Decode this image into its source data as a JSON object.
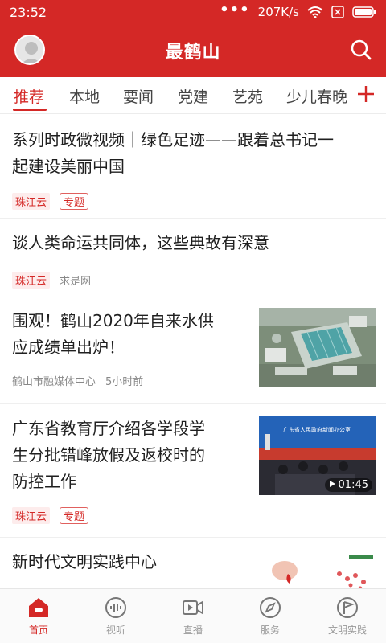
{
  "status_bar": {
    "time": "23:52",
    "dots": "•••",
    "speed": "207K/s"
  },
  "header": {
    "title": "最鹤山",
    "avatar_icon": "user-avatar-icon",
    "search_icon": "search-icon"
  },
  "tabs": {
    "items": [
      {
        "label": "推荐",
        "active": true
      },
      {
        "label": "本地"
      },
      {
        "label": "要闻"
      },
      {
        "label": "党建"
      },
      {
        "label": "艺苑"
      },
      {
        "label": "少儿春晚"
      }
    ],
    "add_icon": "plus-icon"
  },
  "feed": [
    {
      "title_line1": "系列时政微视频｜绿色足迹——跟着总书记一",
      "title_line2": "起建设美丽中国",
      "source": "珠江云",
      "tag": "专题"
    },
    {
      "title_line1": "谈人类命运共同体，这些典故有深意",
      "source": "珠江云",
      "source2": "求是网"
    },
    {
      "title_line1": "围观！鹤山2020年自来水供",
      "title_line2": "应成绩单出炉！",
      "source": "鹤山市融媒体中心",
      "time": "5小时前"
    },
    {
      "title_line1": "广东省教育厅介绍各学段学",
      "title_line2": "生分批错峰放假及返校时的",
      "title_line3": "防控工作",
      "source": "珠江云",
      "tag": "专题",
      "video_duration": "01:45",
      "banner_text": "广东省人民政府新闻办公室"
    },
    {
      "title_line1": "新时代文明实践中心"
    }
  ],
  "bottom_nav": [
    {
      "label": "首页",
      "icon": "home-icon",
      "active": true
    },
    {
      "label": "视听",
      "icon": "audio-wave-icon"
    },
    {
      "label": "直播",
      "icon": "video-camera-icon"
    },
    {
      "label": "服务",
      "icon": "compass-icon"
    },
    {
      "label": "文明实践",
      "icon": "flag-icon"
    }
  ],
  "colors": {
    "brand_red": "#d42826"
  }
}
